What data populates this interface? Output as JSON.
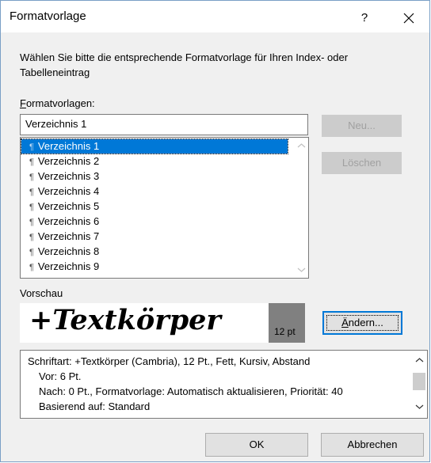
{
  "dialog": {
    "title": "Formatvorlage",
    "help": "?",
    "description": "Wählen Sie bitte die entsprechende Formatvorlage für Ihren Index- oder Tabelleneintrag"
  },
  "styles": {
    "label_prefix": "F",
    "label_rest": "ormatvorlagen:",
    "name_value": "Verzeichnis 1",
    "pilcrow": "¶",
    "items": [
      "Verzeichnis 1",
      "Verzeichnis 2",
      "Verzeichnis 3",
      "Verzeichnis 4",
      "Verzeichnis 5",
      "Verzeichnis 6",
      "Verzeichnis 7",
      "Verzeichnis 8",
      "Verzeichnis 9"
    ],
    "selected": "Verzeichnis 1"
  },
  "buttons": {
    "new": "Neu...",
    "delete": "Löschen",
    "modify_prefix": "Ä",
    "modify_rest": "ndern...",
    "ok": "OK",
    "cancel": "Abbrechen"
  },
  "preview": {
    "label": "Vorschau",
    "sample": "+Textkörper",
    "size": "12 pt"
  },
  "style_description": {
    "lines": [
      "Schriftart: +Textkörper (Cambria), 12 Pt., Fett, Kursiv, Abstand",
      "Vor:  6 Pt.",
      "Nach:  0 Pt., Formatvorlage: Automatisch aktualisieren, Priorität: 40",
      "Basierend auf: Standard"
    ]
  }
}
